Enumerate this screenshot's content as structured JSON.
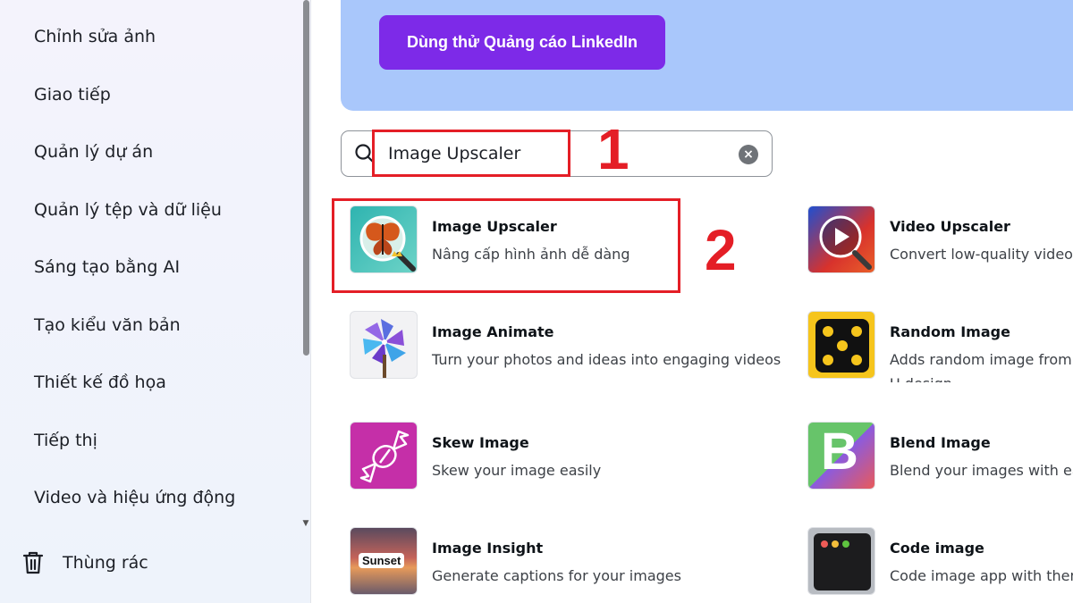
{
  "sidebar": {
    "items": [
      {
        "label": "Chỉnh sửa ảnh"
      },
      {
        "label": "Giao tiếp"
      },
      {
        "label": "Quản lý dự án"
      },
      {
        "label": "Quản lý tệp và dữ liệu"
      },
      {
        "label": "Sáng tạo bằng AI"
      },
      {
        "label": "Tạo kiểu văn bản"
      },
      {
        "label": "Thiết kế đồ họa"
      },
      {
        "label": "Tiếp thị"
      },
      {
        "label": "Video và hiệu ứng động"
      }
    ],
    "trash_label": "Thùng rác"
  },
  "banner": {
    "button_label": "Dùng thử Quảng cáo LinkedIn"
  },
  "search": {
    "value": "Image Upscaler"
  },
  "annotations": {
    "step1": "1",
    "step2": "2"
  },
  "apps": [
    {
      "title": "Image Upscaler",
      "desc": "Nâng cấp hình ảnh dễ dàng",
      "icon": "butterfly-magnifier-icon"
    },
    {
      "title": "Video Upscaler",
      "desc": "Convert low-quality videos i",
      "icon": "video-magnifier-icon"
    },
    {
      "title": "Image Animate",
      "desc": "Turn your photos and ideas into engaging videos",
      "icon": "pinwheel-icon"
    },
    {
      "title": "Random Image",
      "desc": "Adds random image from U design.",
      "icon": "dice-icon"
    },
    {
      "title": "Skew Image",
      "desc": "Skew your image easily",
      "icon": "candy-icon"
    },
    {
      "title": "Blend Image",
      "desc": "Blend your images with eas",
      "icon": "letter-b-icon"
    },
    {
      "title": "Image Insight",
      "desc": "Generate captions for your images",
      "icon": "sunset-icon",
      "thumb_text": "Sunset"
    },
    {
      "title": "Code image",
      "desc": "Code image app with them",
      "icon": "code-window-icon"
    }
  ],
  "colors": {
    "accent": "#7d2ae8",
    "banner_bg": "#a9c7fb",
    "annotation_red": "#e41e26"
  }
}
